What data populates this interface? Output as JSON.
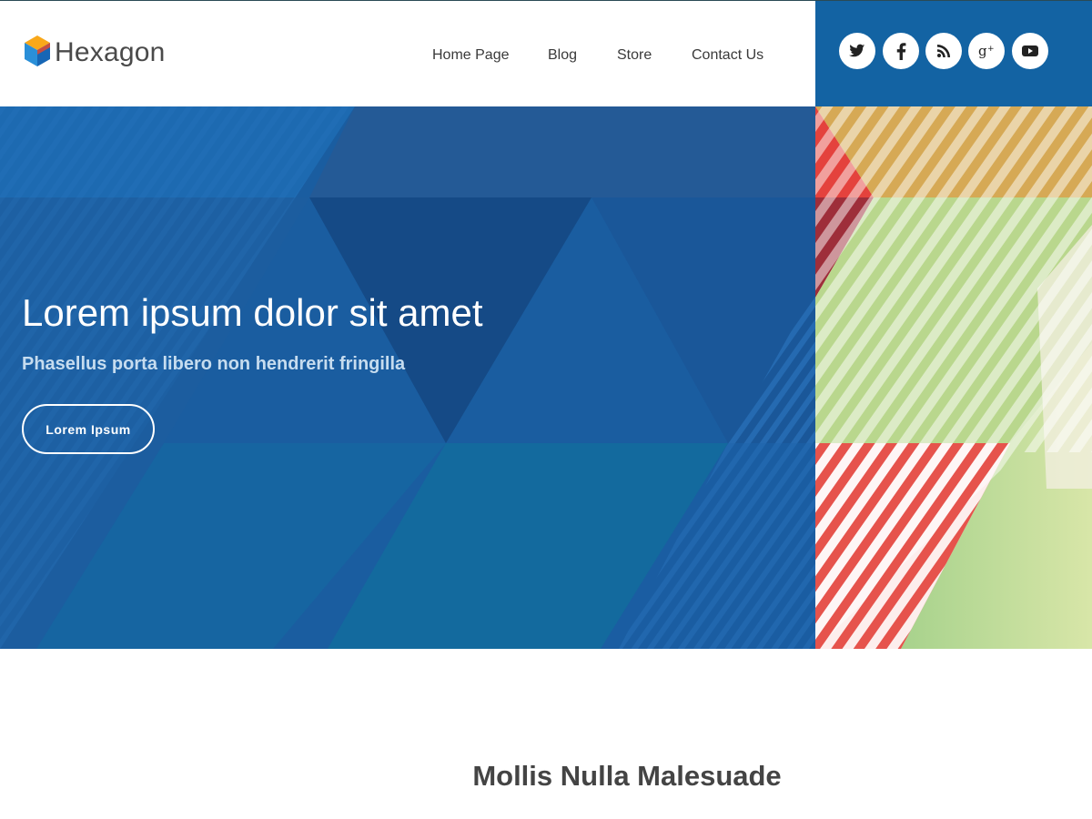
{
  "brand": {
    "name": "Hexagon"
  },
  "nav": {
    "items": [
      {
        "label": "Home Page"
      },
      {
        "label": "Blog"
      },
      {
        "label": "Store"
      },
      {
        "label": "Contact Us"
      }
    ]
  },
  "social": {
    "icons": [
      "twitter-icon",
      "facebook-icon",
      "rss-icon",
      "google-plus-icon",
      "youtube-icon"
    ]
  },
  "hero": {
    "title": "Lorem ipsum dolor sit amet",
    "subtitle": "Phasellus porta libero non hendrerit fringilla",
    "button_label": "Lorem Ipsum"
  },
  "section": {
    "title": "Mollis Nulla Malesuade"
  },
  "colors": {
    "social_bar": "#1363a3",
    "hero_blue": "#16508b",
    "accent_red": "#e64a45",
    "accent_green": "#a8d08d",
    "accent_gold": "#d6a955"
  }
}
